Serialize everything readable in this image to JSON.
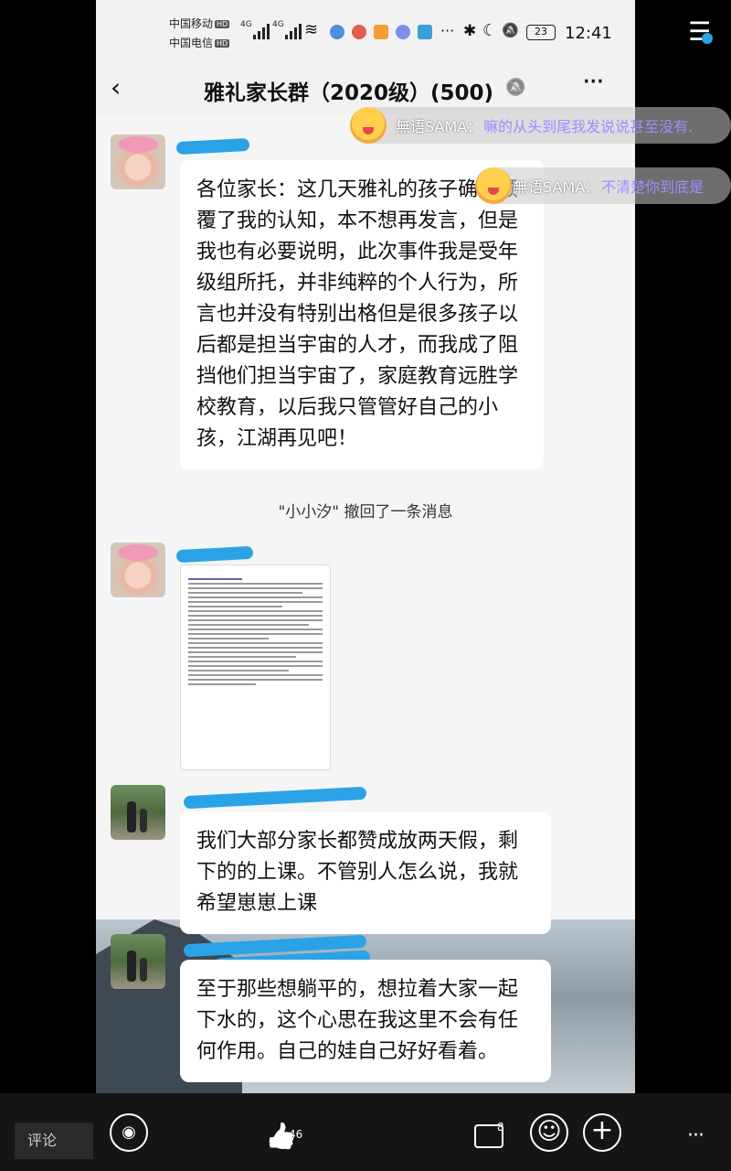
{
  "status": {
    "carrier1": "中国移动",
    "carrier2": "中国电信",
    "hd": "HD",
    "net": "4G",
    "battery": "23",
    "time": "12:41",
    "bt_glyph": "✱",
    "moon_glyph": "☾",
    "bell_glyph": "🔕",
    "dots_glyph": "···"
  },
  "navbar": {
    "back_glyph": "‹",
    "title": "雅礼家长群（2020级）(500)",
    "mute_glyph": "🔕",
    "more_glyph": "···"
  },
  "messages": [
    {
      "text": "各位家长：这几天雅礼的孩子确实颠覆了我的认知，本不想再发言，但是我也有必要说明，此次事件我是受年级组所托，并非纯粹的个人行为，所言也并没有特别出格但是很多孩子以后都是担当宇宙的人才，而我成了阻挡他们担当宇宙了，家庭教育远胜学校教育，以后我只管管好自己的小孩，江湖再见吧！"
    },
    {
      "system": "\"小小汐\" 撤回了一条消息"
    },
    {
      "text": "我们大部分家长都赞成放两天假，剩下的的上课。不管别人怎么说，我就希望崽崽上课"
    },
    {
      "text": "至于那些想躺平的，想拉着大家一起下水的，这个心思在我这里不会有任何作用。自己的娃自己好好看着。"
    }
  ],
  "danmaku": [
    {
      "user": "無语SAMA：",
      "text": "嘛的从头到尾我发说说甚至没有."
    },
    {
      "user": "無语SAMA：",
      "text": "不清楚你到底是"
    }
  ],
  "bottom": {
    "comment_placeholder": "评论",
    "sound_glyph": "◉",
    "like_glyph": "👍",
    "like_count": "46",
    "comment_glyph": "▭",
    "comment_count": "8",
    "emoji_glyph": "☺",
    "add_glyph": "+",
    "more_glyph": "···",
    "menu_glyph": "☰"
  },
  "colors": {
    "scribble": "#2aa3e6",
    "danmaku_text": "#a38bff"
  }
}
